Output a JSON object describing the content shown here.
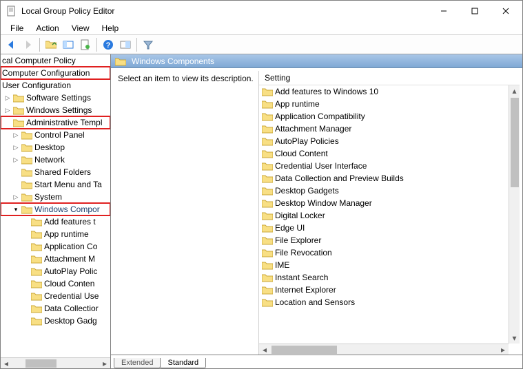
{
  "title": "Local Group Policy Editor",
  "menus": [
    "File",
    "Action",
    "View",
    "Help"
  ],
  "tree": {
    "root": "cal Computer Policy",
    "compConfig": "Computer Configuration",
    "userConfig": "User Configuration",
    "softwareSettings": "Software Settings",
    "windowsSettings": "Windows Settings",
    "adminTempl": "Administrative Templ",
    "controlPanel": "Control Panel",
    "desktop": "Desktop",
    "network": "Network",
    "sharedFolders": "Shared Folders",
    "startMenu": "Start Menu and Ta",
    "system": "System",
    "winComp": "Windows Compor",
    "sub": {
      "addFeatures": "Add features t",
      "appRuntime": "App runtime",
      "appCompat": "Application Co",
      "attachMgr": "Attachment M",
      "autoPlay": "AutoPlay Polic",
      "cloud": "Cloud Conten",
      "credUI": "Credential Use",
      "dataColl": "Data Collectior",
      "desktopGad": "Desktop Gadg"
    }
  },
  "header": "Windows Components",
  "description": "Select an item to view its description.",
  "settingHeader": "Setting",
  "settings": [
    "Add features to Windows 10",
    "App runtime",
    "Application Compatibility",
    "Attachment Manager",
    "AutoPlay Policies",
    "Cloud Content",
    "Credential User Interface",
    "Data Collection and Preview Builds",
    "Desktop Gadgets",
    "Desktop Window Manager",
    "Digital Locker",
    "Edge UI",
    "File Explorer",
    "File Revocation",
    "IME",
    "Instant Search",
    "Internet Explorer",
    "Location and Sensors"
  ],
  "tabs": {
    "extended": "Extended",
    "standard": "Standard"
  }
}
